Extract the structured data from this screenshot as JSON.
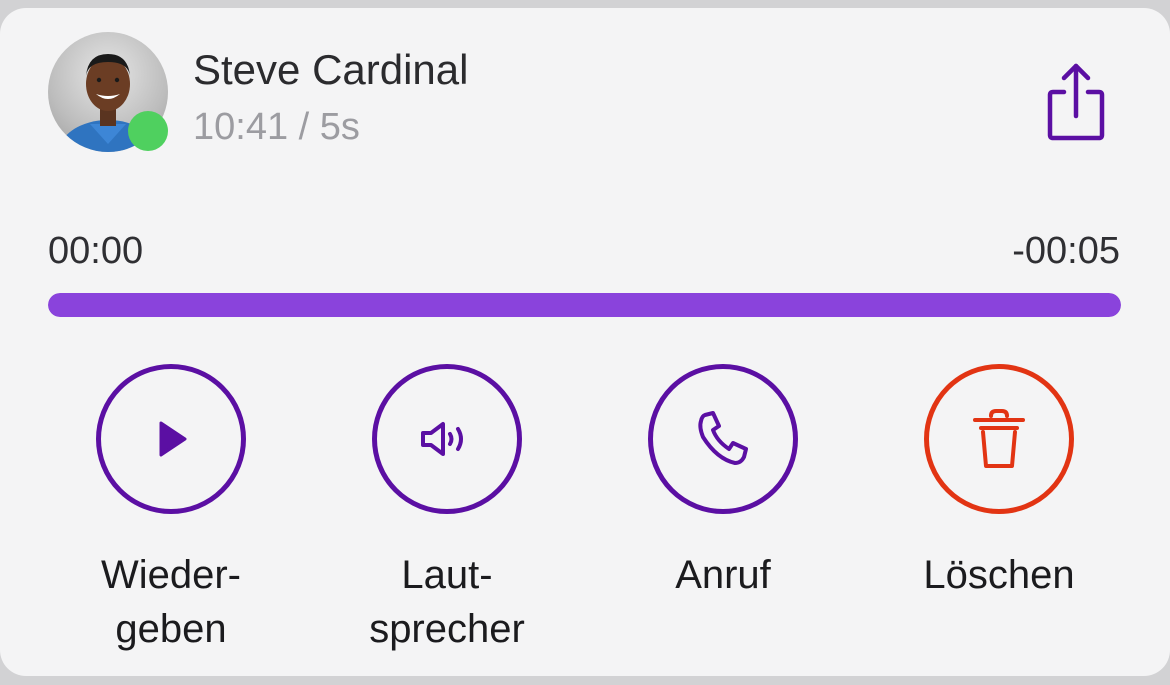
{
  "contact": {
    "name": "Steve Cardinal",
    "meta": "10:41 / 5s",
    "status": "online"
  },
  "player": {
    "elapsed": "00:00",
    "remaining": "-00:05",
    "progress_fraction": 1.0
  },
  "actions": [
    {
      "icon": "play-icon",
      "label_line1": "Wieder-",
      "label_line2": "geben"
    },
    {
      "icon": "speaker-icon",
      "label_line1": "Laut-",
      "label_line2": "sprecher"
    },
    {
      "icon": "phone-icon",
      "label_line1": "Anruf",
      "label_line2": ""
    },
    {
      "icon": "trash-icon",
      "label_line1": "Löschen",
      "label_line2": ""
    }
  ],
  "colors": {
    "accent": "#5b0fa3",
    "progress": "#8a43dc",
    "danger": "#e23413",
    "online": "#4fd05f"
  }
}
